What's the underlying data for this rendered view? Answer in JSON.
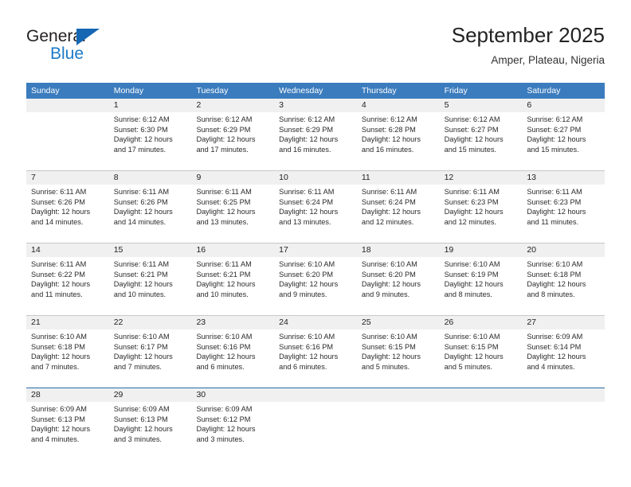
{
  "brand": {
    "name_part1": "General",
    "name_part2": "Blue",
    "triangle_icon": "triangle-icon",
    "accent_color": "#1b79c8"
  },
  "header": {
    "title": "September 2025",
    "subtitle": "Amper, Plateau, Nigeria"
  },
  "calendar": {
    "header_bg": "#3b7cbe",
    "daterow_bg": "#f0f0f0",
    "weekdays": [
      "Sunday",
      "Monday",
      "Tuesday",
      "Wednesday",
      "Thursday",
      "Friday",
      "Saturday"
    ],
    "weeks": [
      {
        "separator": "none",
        "days": [
          {
            "num": "",
            "lines": []
          },
          {
            "num": "1",
            "lines": [
              "Sunrise: 6:12 AM",
              "Sunset: 6:30 PM",
              "Daylight: 12 hours",
              "and 17 minutes."
            ]
          },
          {
            "num": "2",
            "lines": [
              "Sunrise: 6:12 AM",
              "Sunset: 6:29 PM",
              "Daylight: 12 hours",
              "and 17 minutes."
            ]
          },
          {
            "num": "3",
            "lines": [
              "Sunrise: 6:12 AM",
              "Sunset: 6:29 PM",
              "Daylight: 12 hours",
              "and 16 minutes."
            ]
          },
          {
            "num": "4",
            "lines": [
              "Sunrise: 6:12 AM",
              "Sunset: 6:28 PM",
              "Daylight: 12 hours",
              "and 16 minutes."
            ]
          },
          {
            "num": "5",
            "lines": [
              "Sunrise: 6:12 AM",
              "Sunset: 6:27 PM",
              "Daylight: 12 hours",
              "and 15 minutes."
            ]
          },
          {
            "num": "6",
            "lines": [
              "Sunrise: 6:12 AM",
              "Sunset: 6:27 PM",
              "Daylight: 12 hours",
              "and 15 minutes."
            ]
          }
        ]
      },
      {
        "separator": "gray",
        "days": [
          {
            "num": "7",
            "lines": [
              "Sunrise: 6:11 AM",
              "Sunset: 6:26 PM",
              "Daylight: 12 hours",
              "and 14 minutes."
            ]
          },
          {
            "num": "8",
            "lines": [
              "Sunrise: 6:11 AM",
              "Sunset: 6:26 PM",
              "Daylight: 12 hours",
              "and 14 minutes."
            ]
          },
          {
            "num": "9",
            "lines": [
              "Sunrise: 6:11 AM",
              "Sunset: 6:25 PM",
              "Daylight: 12 hours",
              "and 13 minutes."
            ]
          },
          {
            "num": "10",
            "lines": [
              "Sunrise: 6:11 AM",
              "Sunset: 6:24 PM",
              "Daylight: 12 hours",
              "and 13 minutes."
            ]
          },
          {
            "num": "11",
            "lines": [
              "Sunrise: 6:11 AM",
              "Sunset: 6:24 PM",
              "Daylight: 12 hours",
              "and 12 minutes."
            ]
          },
          {
            "num": "12",
            "lines": [
              "Sunrise: 6:11 AM",
              "Sunset: 6:23 PM",
              "Daylight: 12 hours",
              "and 12 minutes."
            ]
          },
          {
            "num": "13",
            "lines": [
              "Sunrise: 6:11 AM",
              "Sunset: 6:23 PM",
              "Daylight: 12 hours",
              "and 11 minutes."
            ]
          }
        ]
      },
      {
        "separator": "gray",
        "days": [
          {
            "num": "14",
            "lines": [
              "Sunrise: 6:11 AM",
              "Sunset: 6:22 PM",
              "Daylight: 12 hours",
              "and 11 minutes."
            ]
          },
          {
            "num": "15",
            "lines": [
              "Sunrise: 6:11 AM",
              "Sunset: 6:21 PM",
              "Daylight: 12 hours",
              "and 10 minutes."
            ]
          },
          {
            "num": "16",
            "lines": [
              "Sunrise: 6:11 AM",
              "Sunset: 6:21 PM",
              "Daylight: 12 hours",
              "and 10 minutes."
            ]
          },
          {
            "num": "17",
            "lines": [
              "Sunrise: 6:10 AM",
              "Sunset: 6:20 PM",
              "Daylight: 12 hours",
              "and 9 minutes."
            ]
          },
          {
            "num": "18",
            "lines": [
              "Sunrise: 6:10 AM",
              "Sunset: 6:20 PM",
              "Daylight: 12 hours",
              "and 9 minutes."
            ]
          },
          {
            "num": "19",
            "lines": [
              "Sunrise: 6:10 AM",
              "Sunset: 6:19 PM",
              "Daylight: 12 hours",
              "and 8 minutes."
            ]
          },
          {
            "num": "20",
            "lines": [
              "Sunrise: 6:10 AM",
              "Sunset: 6:18 PM",
              "Daylight: 12 hours",
              "and 8 minutes."
            ]
          }
        ]
      },
      {
        "separator": "gray",
        "days": [
          {
            "num": "21",
            "lines": [
              "Sunrise: 6:10 AM",
              "Sunset: 6:18 PM",
              "Daylight: 12 hours",
              "and 7 minutes."
            ]
          },
          {
            "num": "22",
            "lines": [
              "Sunrise: 6:10 AM",
              "Sunset: 6:17 PM",
              "Daylight: 12 hours",
              "and 7 minutes."
            ]
          },
          {
            "num": "23",
            "lines": [
              "Sunrise: 6:10 AM",
              "Sunset: 6:16 PM",
              "Daylight: 12 hours",
              "and 6 minutes."
            ]
          },
          {
            "num": "24",
            "lines": [
              "Sunrise: 6:10 AM",
              "Sunset: 6:16 PM",
              "Daylight: 12 hours",
              "and 6 minutes."
            ]
          },
          {
            "num": "25",
            "lines": [
              "Sunrise: 6:10 AM",
              "Sunset: 6:15 PM",
              "Daylight: 12 hours",
              "and 5 minutes."
            ]
          },
          {
            "num": "26",
            "lines": [
              "Sunrise: 6:10 AM",
              "Sunset: 6:15 PM",
              "Daylight: 12 hours",
              "and 5 minutes."
            ]
          },
          {
            "num": "27",
            "lines": [
              "Sunrise: 6:09 AM",
              "Sunset: 6:14 PM",
              "Daylight: 12 hours",
              "and 4 minutes."
            ]
          }
        ]
      },
      {
        "separator": "blue",
        "days": [
          {
            "num": "28",
            "lines": [
              "Sunrise: 6:09 AM",
              "Sunset: 6:13 PM",
              "Daylight: 12 hours",
              "and 4 minutes."
            ]
          },
          {
            "num": "29",
            "lines": [
              "Sunrise: 6:09 AM",
              "Sunset: 6:13 PM",
              "Daylight: 12 hours",
              "and 3 minutes."
            ]
          },
          {
            "num": "30",
            "lines": [
              "Sunrise: 6:09 AM",
              "Sunset: 6:12 PM",
              "Daylight: 12 hours",
              "and 3 minutes."
            ]
          },
          {
            "num": "",
            "lines": []
          },
          {
            "num": "",
            "lines": []
          },
          {
            "num": "",
            "lines": []
          },
          {
            "num": "",
            "lines": []
          }
        ]
      }
    ]
  }
}
